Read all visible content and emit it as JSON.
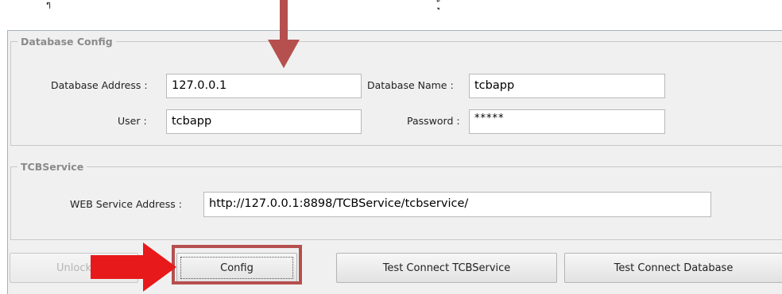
{
  "top_fragments": [
    "ๆ",
    "ู้"
  ],
  "database_config": {
    "title": "Database Config",
    "address_label": "Database Address :",
    "address_value": "127.0.0.1",
    "name_label": "Database Name :",
    "name_value": "tcbapp",
    "user_label": "User :",
    "user_value": "tcbapp",
    "password_label": "Password :",
    "password_value": "*****"
  },
  "tcb_service": {
    "title": "TCBService",
    "address_label": "WEB Service Address :",
    "address_value": "http://127.0.0.1:8898/TCBService/tcbservice/"
  },
  "buttons": {
    "unlock": "Unlock",
    "config": "Config",
    "test_tcbservice": "Test Connect TCBService",
    "test_database": "Test Connect Database"
  },
  "colors": {
    "annotation_arrow": "#e8191a",
    "highlight_outline": "#b5504f",
    "down_arrow": "#b5504f"
  }
}
